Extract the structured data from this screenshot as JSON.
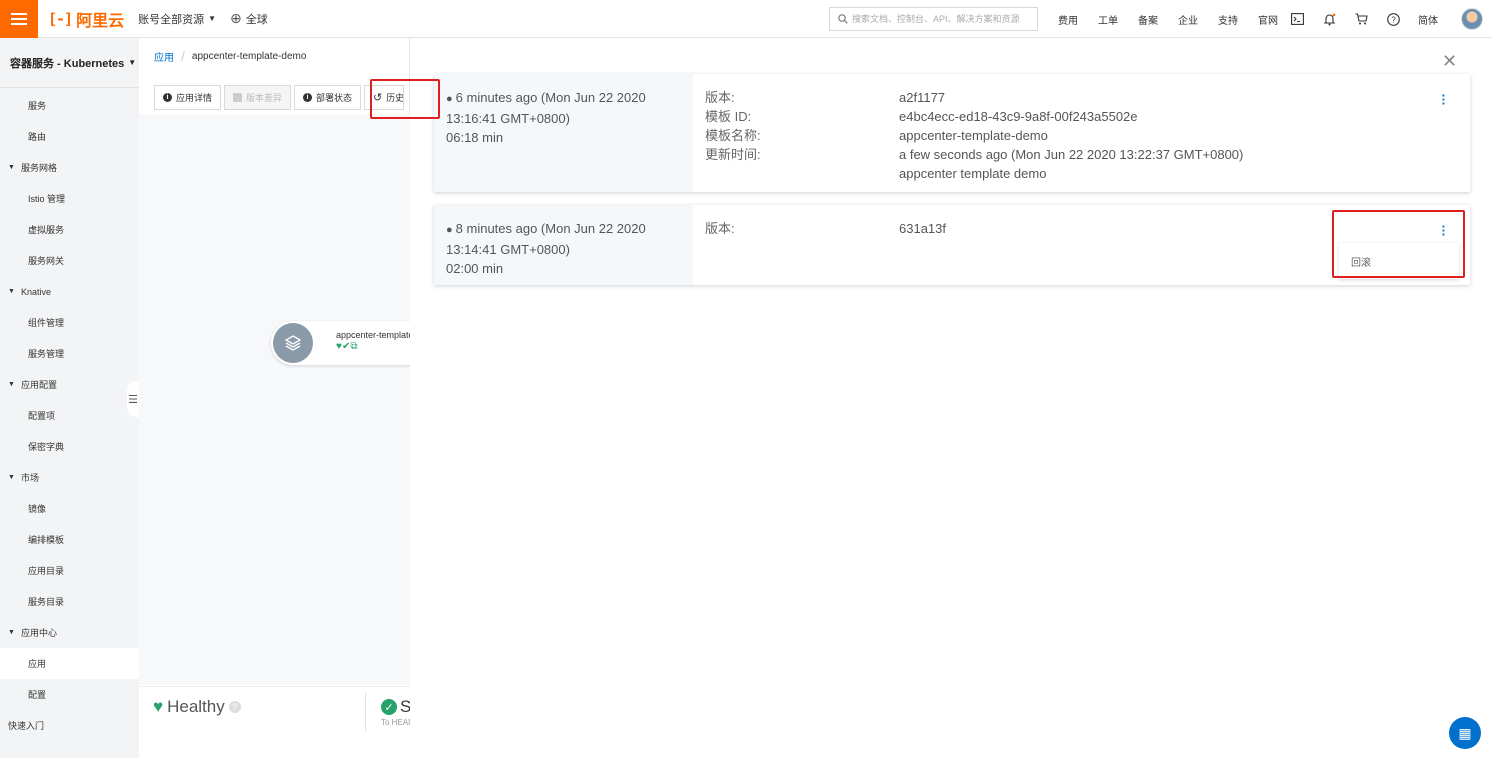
{
  "topbar": {
    "brand": "阿里云",
    "account_scope": "账号全部资源",
    "region": "全球",
    "search_placeholder": "搜索文档、控制台、API、解决方案和资源",
    "menu": [
      "费用",
      "工单",
      "备案",
      "企业",
      "支持",
      "官网"
    ],
    "language": "简体",
    "icons": [
      "terminal-icon",
      "bell-icon",
      "cart-icon",
      "help-icon"
    ]
  },
  "sidebar": {
    "title": "容器服务 - Kubernetes",
    "items": [
      {
        "type": "item",
        "label": "服务"
      },
      {
        "type": "item",
        "label": "路由"
      },
      {
        "type": "group",
        "label": "服务网格"
      },
      {
        "type": "item",
        "label": "Istio 管理"
      },
      {
        "type": "item",
        "label": "虚拟服务"
      },
      {
        "type": "item",
        "label": "服务网关"
      },
      {
        "type": "group",
        "label": "Knative"
      },
      {
        "type": "item",
        "label": "组件管理"
      },
      {
        "type": "item",
        "label": "服务管理"
      },
      {
        "type": "group",
        "label": "应用配置"
      },
      {
        "type": "item",
        "label": "配置项"
      },
      {
        "type": "item",
        "label": "保密字典"
      },
      {
        "type": "group",
        "label": "市场"
      },
      {
        "type": "item",
        "label": "镜像"
      },
      {
        "type": "item",
        "label": "编排模板"
      },
      {
        "type": "item",
        "label": "应用目录"
      },
      {
        "type": "item",
        "label": "服务目录"
      },
      {
        "type": "group",
        "label": "应用中心"
      },
      {
        "type": "item",
        "label": "应用",
        "active": true
      },
      {
        "type": "item",
        "label": "配置"
      },
      {
        "type": "group-plain",
        "label": "快速入门"
      }
    ]
  },
  "middle": {
    "breadcrumb_root": "应用",
    "breadcrumb_current": "appcenter-template-demo",
    "buttons": {
      "details": "应用详情",
      "diff": "版本差异",
      "deploy_status": "部署状态",
      "history": "历史"
    },
    "node_name": "appcenter-template-demo",
    "health_label": "Healthy",
    "sync_label": "Synced",
    "sync_sub": "To HEAD"
  },
  "history": [
    {
      "time_line1": "6 minutes ago (Mon Jun 22 2020",
      "time_line2": "13:16:41 GMT+0800)",
      "duration": "06:18 min",
      "fields": [
        {
          "k": "版本:",
          "v": "a2f1177"
        },
        {
          "k": "模板 ID:",
          "v": "e4bc4ecc-ed18-43c9-9a8f-00f243a5502e"
        },
        {
          "k": "模板名称:",
          "v": "appcenter-template-demo"
        },
        {
          "k": "更新时间:",
          "v": "a few seconds ago (Mon Jun 22 2020 13:22:37 GMT+0800)"
        },
        {
          "k": "",
          "v": "appcenter template demo"
        }
      ]
    },
    {
      "time_line1": "8 minutes ago (Mon Jun 22 2020",
      "time_line2": "13:14:41 GMT+0800)",
      "duration": "02:00 min",
      "fields": [
        {
          "k": "版本:",
          "v": "631a13f"
        }
      ]
    }
  ],
  "dropdown_option": "回滚"
}
